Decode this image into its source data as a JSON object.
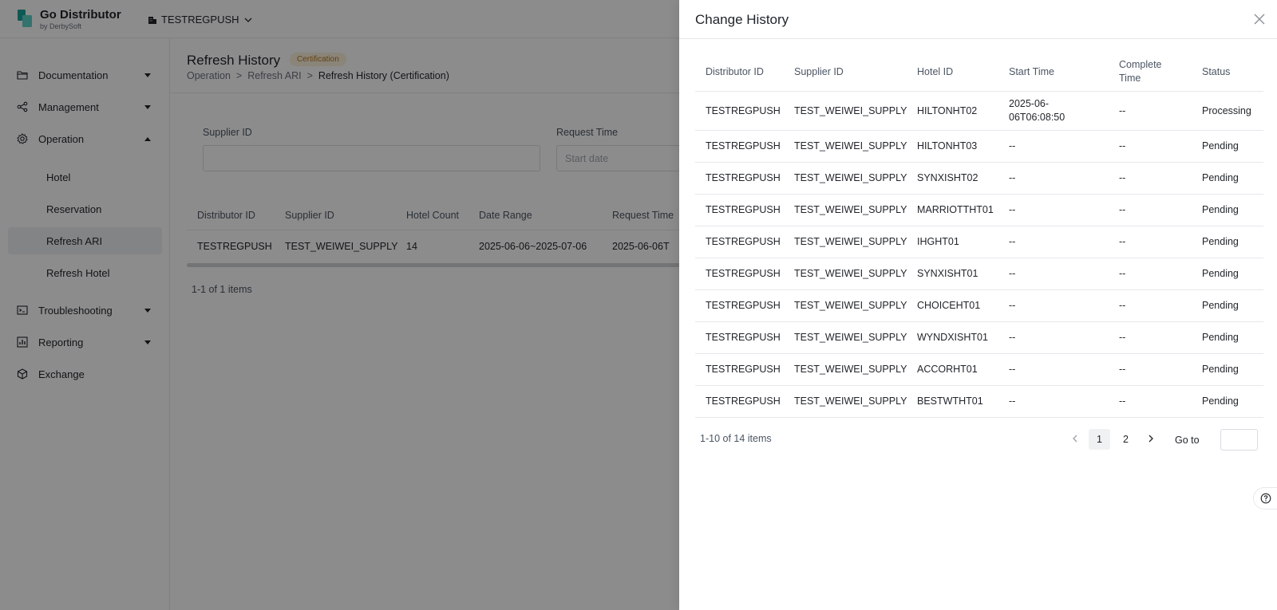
{
  "app": {
    "brand_name": "Go Distributor",
    "brand_sub": "by DerbySoft",
    "tenant": "TESTREGPUSH"
  },
  "sidebar": {
    "items": [
      {
        "label": "Documentation",
        "icon": "folder-icon"
      },
      {
        "label": "Management",
        "icon": "share-icon"
      },
      {
        "label": "Operation",
        "icon": "gear-icon"
      },
      {
        "label": "Troubleshooting",
        "icon": "terminal-icon"
      },
      {
        "label": "Reporting",
        "icon": "bar-chart-icon"
      },
      {
        "label": "Exchange",
        "icon": "cube-icon"
      }
    ],
    "operation_sub": [
      "Hotel",
      "Reservation",
      "Refresh ARI",
      "Refresh Hotel"
    ],
    "active_sub": "Refresh ARI"
  },
  "page": {
    "title": "Refresh History",
    "tag": "Certification",
    "breadcrumb": [
      "Operation",
      "Refresh ARI",
      "Refresh History (Certification)"
    ],
    "breadcrumb_sep": ">",
    "filters": {
      "supplier_label": "Supplier ID",
      "request_time_label": "Request Time",
      "start_date_placeholder": "Start date"
    },
    "grid": {
      "columns": [
        "Distributor ID",
        "Supplier ID",
        "Hotel Count",
        "Date Range",
        "Request Time"
      ],
      "rows": [
        [
          "TESTREGPUSH",
          "TEST_WEIWEI_SUPPLY",
          "14",
          "2025-06-06~2025-07-06",
          "2025-06-06T"
        ]
      ],
      "count": "1-1 of 1 items"
    }
  },
  "drawer": {
    "title": "Change History",
    "columns": [
      "Distributor ID",
      "Supplier ID",
      "Hotel ID",
      "Start Time",
      "Complete Time",
      "Status"
    ],
    "rows": [
      [
        "TESTREGPUSH",
        "TEST_WEIWEI_SUPPLY",
        "HILTONHT02",
        "2025-06-06T06:08:50",
        "--",
        "Processing"
      ],
      [
        "TESTREGPUSH",
        "TEST_WEIWEI_SUPPLY",
        "HILTONHT03",
        "--",
        "--",
        "Pending"
      ],
      [
        "TESTREGPUSH",
        "TEST_WEIWEI_SUPPLY",
        "SYNXISHT02",
        "--",
        "--",
        "Pending"
      ],
      [
        "TESTREGPUSH",
        "TEST_WEIWEI_SUPPLY",
        "MARRIOTTHT01",
        "--",
        "--",
        "Pending"
      ],
      [
        "TESTREGPUSH",
        "TEST_WEIWEI_SUPPLY",
        "IHGHT01",
        "--",
        "--",
        "Pending"
      ],
      [
        "TESTREGPUSH",
        "TEST_WEIWEI_SUPPLY",
        "SYNXISHT01",
        "--",
        "--",
        "Pending"
      ],
      [
        "TESTREGPUSH",
        "TEST_WEIWEI_SUPPLY",
        "CHOICEHT01",
        "--",
        "--",
        "Pending"
      ],
      [
        "TESTREGPUSH",
        "TEST_WEIWEI_SUPPLY",
        "WYNDXISHT01",
        "--",
        "--",
        "Pending"
      ],
      [
        "TESTREGPUSH",
        "TEST_WEIWEI_SUPPLY",
        "ACCORHT01",
        "--",
        "--",
        "Pending"
      ],
      [
        "TESTREGPUSH",
        "TEST_WEIWEI_SUPPLY",
        "BESTWTHT01",
        "--",
        "--",
        "Pending"
      ]
    ],
    "pagination": {
      "count": "1-10 of 14 items",
      "pages": [
        "1",
        "2"
      ],
      "current": "1",
      "goto_label": "Go to",
      "goto_value": ""
    }
  },
  "colors": {
    "accent": "#1aa39a",
    "overlay": "rgba(0,0,0,0.45)",
    "tag_bg": "#fbf1dc",
    "tag_fg": "#b7791f"
  }
}
